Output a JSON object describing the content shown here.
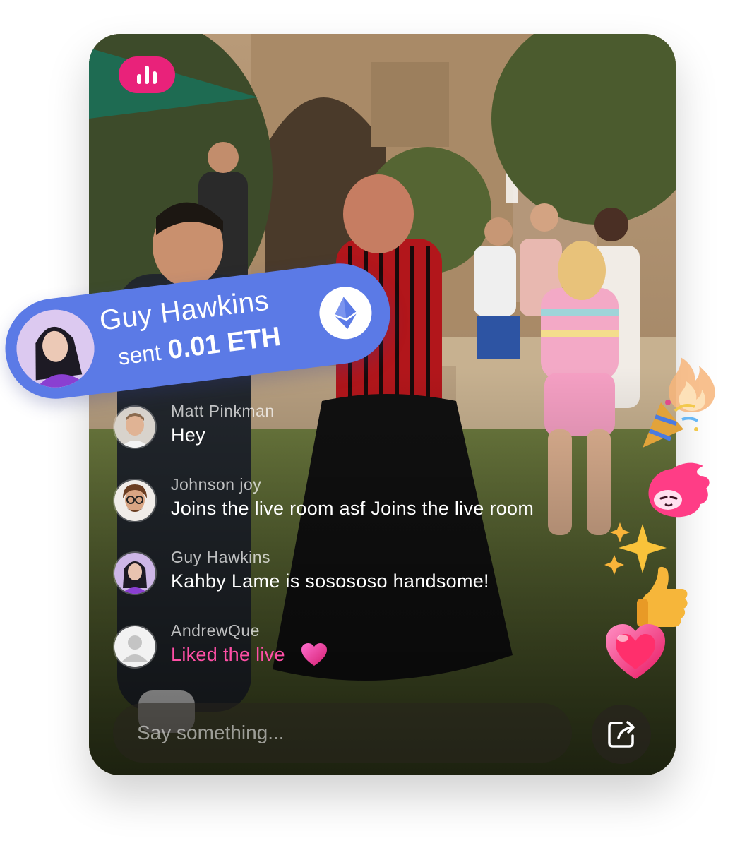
{
  "gift": {
    "sender": "Guy Hawkins",
    "verb": "sent",
    "amount": "0.01 ETH",
    "currency_icon": "ethereum-icon"
  },
  "top_bar": {
    "stats_icon": "bar-chart-icon"
  },
  "chat": [
    {
      "name": "Matt Pinkman",
      "message": "Hey",
      "avatar": "avatar-man-smiling"
    },
    {
      "name": "Johnson joy",
      "message": "Joins the live room asf Joins the live room",
      "avatar": "avatar-man-glasses"
    },
    {
      "name": "Guy Hawkins",
      "message": "Kahby Lame is sosososo handsome!",
      "avatar": "avatar-woman-purple"
    },
    {
      "name": "AndrewQue",
      "message": "Liked the live",
      "avatar": "avatar-placeholder",
      "icon": "heart-icon"
    }
  ],
  "composer": {
    "placeholder": "Say something...",
    "share_icon": "share-icon"
  },
  "reactions": [
    "fire-icon",
    "party-popper-icon",
    "pink-blob-emoji-icon",
    "sparkles-icon",
    "thumbs-up-icon",
    "heart-icon"
  ],
  "colors": {
    "accent_pink": "#e9227a",
    "banner_blue": "#5b7ae6",
    "liked_pink": "#ff4fa6"
  }
}
